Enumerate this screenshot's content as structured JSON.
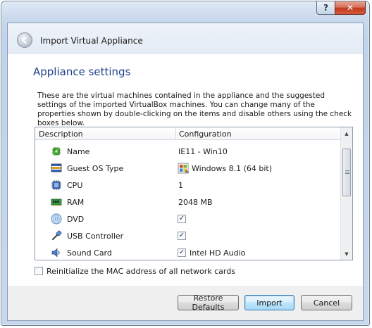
{
  "window": {
    "help_label": "?",
    "close_label": "✕"
  },
  "wizard": {
    "title": "Import Virtual Appliance",
    "heading": "Appliance settings",
    "description": "These are the virtual machines contained in the appliance and the suggested settings of the imported VirtualBox machines. You can change many of the properties shown by double-clicking on the items and disable others using the check boxes below."
  },
  "grid": {
    "headers": [
      "Description",
      "Configuration"
    ],
    "rows": [
      {
        "label": "Name",
        "value": "IE11 - Win10",
        "icon": "name-icon"
      },
      {
        "label": "Guest OS Type",
        "value": "Windows 8.1 (64 bit)",
        "icon": "os-type-icon"
      },
      {
        "label": "CPU",
        "value": "1",
        "icon": "cpu-icon"
      },
      {
        "label": "RAM",
        "value": "2048 MB",
        "icon": "ram-icon"
      },
      {
        "label": "DVD",
        "checked": true,
        "icon": "dvd-icon"
      },
      {
        "label": "USB Controller",
        "checked": true,
        "icon": "usb-icon"
      },
      {
        "label": "Sound Card",
        "checked": true,
        "value": "Intel HD Audio",
        "icon": "sound-card-icon"
      }
    ]
  },
  "options": {
    "reinit_mac_label": "Reinitialize the MAC address of all network cards",
    "reinit_mac_checked": false
  },
  "buttons": {
    "restore_defaults": "Restore Defaults",
    "import": "Import",
    "cancel": "Cancel"
  },
  "colors": {
    "heading": "#1e3f8a",
    "close_button": "#c0391f",
    "default_button_border": "#3c7fb1"
  }
}
